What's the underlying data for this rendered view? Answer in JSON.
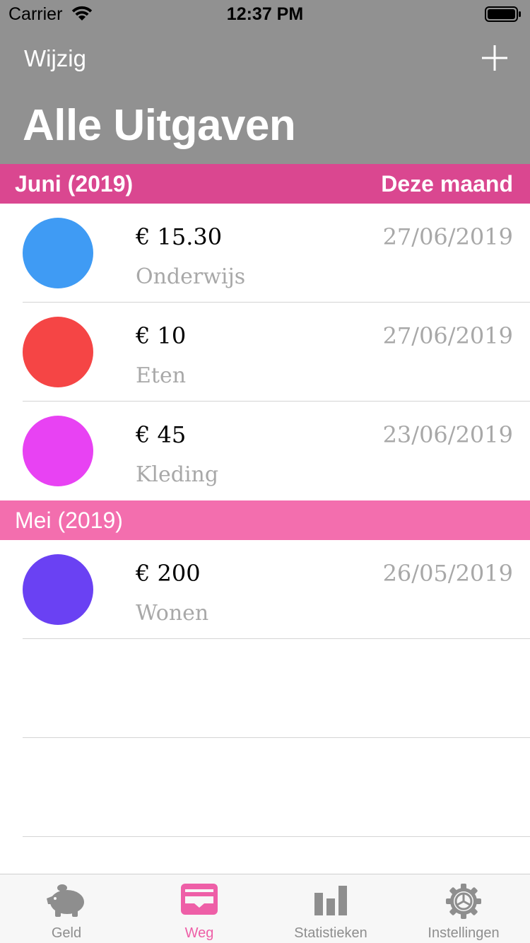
{
  "status_bar": {
    "carrier": "Carrier",
    "time": "12:37 PM"
  },
  "nav": {
    "edit_label": "Wijzig",
    "title": "Alle Uitgaven",
    "add_icon": "plus-icon"
  },
  "sections": [
    {
      "title": "Juni (2019)",
      "badge": "Deze maand",
      "color": "#da4790",
      "rows": [
        {
          "amount": "€ 15.30",
          "category": "Onderwijs",
          "date": "27/06/2019",
          "color": "#3f9bf4"
        },
        {
          "amount": "€ 10",
          "category": "Eten",
          "date": "27/06/2019",
          "color": "#f54545"
        },
        {
          "amount": "€ 45",
          "category": "Kleding",
          "date": "23/06/2019",
          "color": "#e842f3"
        }
      ]
    },
    {
      "title": "Mei (2019)",
      "color": "#f36eae",
      "rows": [
        {
          "amount": "€ 200",
          "category": "Wonen",
          "date": "26/05/2019",
          "color": "#6a41f3"
        }
      ]
    }
  ],
  "tab_bar": {
    "tabs": [
      {
        "label": "Geld",
        "icon": "piggy-bank-icon",
        "active": false
      },
      {
        "label": "Weg",
        "icon": "wallet-icon",
        "active": true
      },
      {
        "label": "Statistieken",
        "icon": "bar-chart-icon",
        "active": false
      },
      {
        "label": "Instellingen",
        "icon": "gear-icon",
        "active": false
      }
    ],
    "active_color": "#ee5fa7",
    "inactive_color": "#8e8e8e"
  }
}
